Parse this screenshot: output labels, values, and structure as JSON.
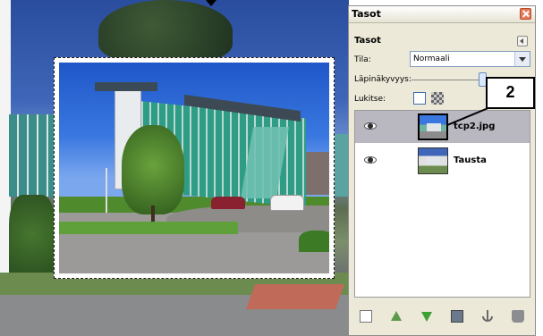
{
  "panel": {
    "title": "Tasot",
    "tab_label": "Tasot",
    "mode_label": "Tila:",
    "mode_value": "Normaali",
    "opacity_label": "Läpinäkyvyys:",
    "opacity_fraction": 0.95,
    "lock_label": "Lukitse:",
    "layers": [
      {
        "name": "tcp2.jpg",
        "visible": true,
        "selected": true
      },
      {
        "name": "Tausta",
        "visible": true,
        "selected": false
      }
    ],
    "bottom_tools": [
      "new-layer-icon",
      "raise-layer-icon",
      "lower-layer-icon",
      "duplicate-layer-icon",
      "anchor-icon",
      "delete-layer-icon"
    ]
  },
  "callout": {
    "label": "2"
  },
  "colors": {
    "selected_row": "#b9b7c0",
    "panel_bg": "#ece9d8",
    "close_button": "#e57a5b"
  }
}
